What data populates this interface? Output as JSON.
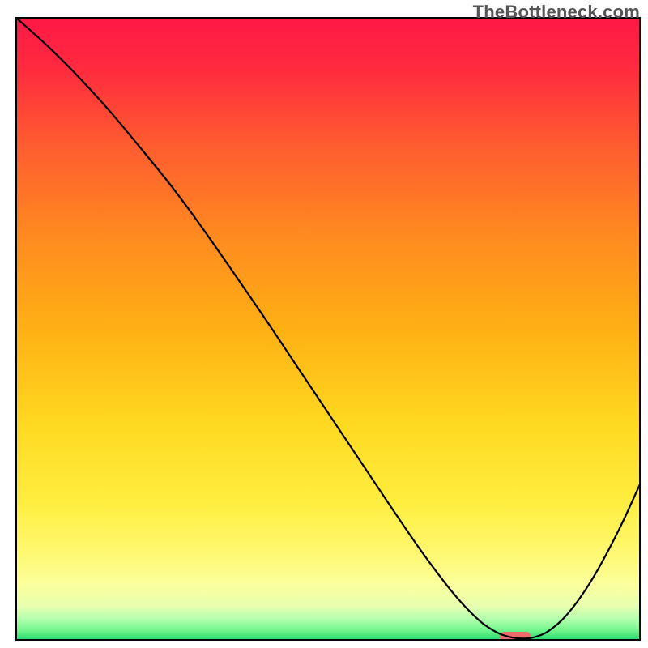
{
  "watermark": "TheBottleneck.com",
  "chart_data": {
    "type": "line",
    "title": "",
    "xlabel": "",
    "ylabel": "",
    "xlim": [
      0,
      100
    ],
    "ylim": [
      0,
      100
    ],
    "gradient_stops": [
      {
        "offset": 0.0,
        "color": "#ff1846"
      },
      {
        "offset": 0.08,
        "color": "#ff2a3f"
      },
      {
        "offset": 0.2,
        "color": "#ff5a30"
      },
      {
        "offset": 0.35,
        "color": "#ff8a20"
      },
      {
        "offset": 0.5,
        "color": "#ffb014"
      },
      {
        "offset": 0.65,
        "color": "#ffd820"
      },
      {
        "offset": 0.78,
        "color": "#ffee40"
      },
      {
        "offset": 0.86,
        "color": "#fff870"
      },
      {
        "offset": 0.91,
        "color": "#fcff9c"
      },
      {
        "offset": 0.945,
        "color": "#e8ffb0"
      },
      {
        "offset": 0.965,
        "color": "#b8ffb0"
      },
      {
        "offset": 0.985,
        "color": "#70f58c"
      },
      {
        "offset": 1.0,
        "color": "#25d870"
      }
    ],
    "series": [
      {
        "name": "bottleneck-curve",
        "stroke": "#000000",
        "stroke_width": 2.2,
        "x": [
          0,
          5,
          10,
          15,
          20,
          25,
          30,
          35,
          40,
          45,
          50,
          55,
          60,
          62.5,
          65,
          67.5,
          70,
          72.5,
          75,
          77.5,
          80,
          82.5,
          85,
          87.5,
          90,
          92.5,
          95,
          97.5,
          100
        ],
        "y": [
          100,
          95.5,
          90.5,
          85,
          79,
          72.8,
          66,
          58.8,
          51.5,
          44,
          36.5,
          29,
          21.5,
          17.8,
          14.2,
          10.8,
          7.6,
          4.8,
          2.5,
          1.0,
          0.3,
          0.3,
          1.2,
          3.2,
          6.2,
          10.0,
          14.5,
          19.5,
          25
        ]
      }
    ],
    "marker": {
      "name": "optimal-zone",
      "x_center": 80,
      "x_halfwidth": 2.5,
      "y": 0.6,
      "color": "#ef6a6a",
      "height": 1.4
    },
    "frame_stroke": "#000000",
    "frame_width": 2
  }
}
